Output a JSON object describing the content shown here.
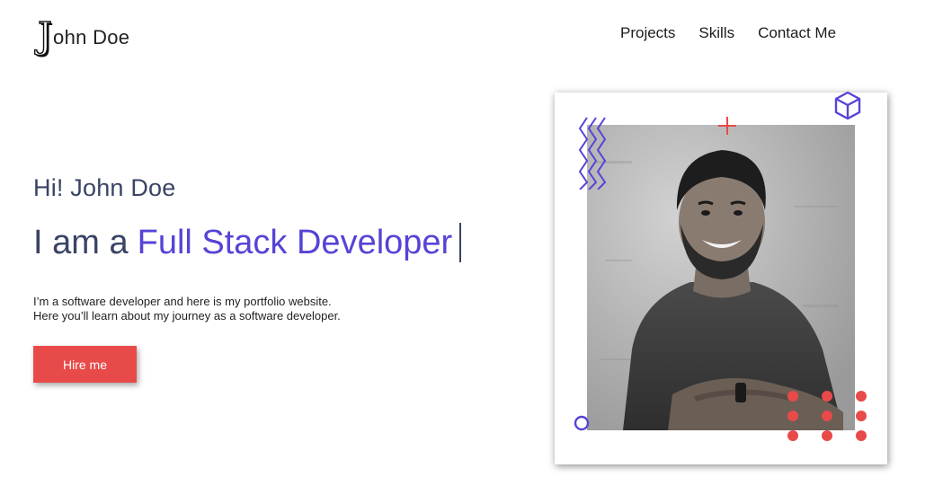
{
  "header": {
    "logo_initial": "J",
    "logo_rest": "ohn Doe",
    "nav": [
      {
        "label": "Projects"
      },
      {
        "label": "Skills"
      },
      {
        "label": "Contact Me"
      }
    ]
  },
  "hero": {
    "greeting": "Hi! John Doe",
    "headline_prefix": "I am a",
    "headline_role": "Full Stack Developer",
    "description_line1": "I’m a software developer and here is my portfolio website.",
    "description_line2": "Here you’ll learn about my journey as a software developer.",
    "cta_label": "Hire me"
  },
  "colors": {
    "accent_purple": "#5544d6",
    "accent_red": "#e84a4a",
    "text_navy": "#3a4366"
  },
  "icons": {
    "zigzag": "zigzag-decoration-icon",
    "cube": "cube-outline-icon",
    "plus": "plus-decoration-icon",
    "circle": "circle-outline-icon",
    "dots": "dot-grid-decoration-icon"
  }
}
